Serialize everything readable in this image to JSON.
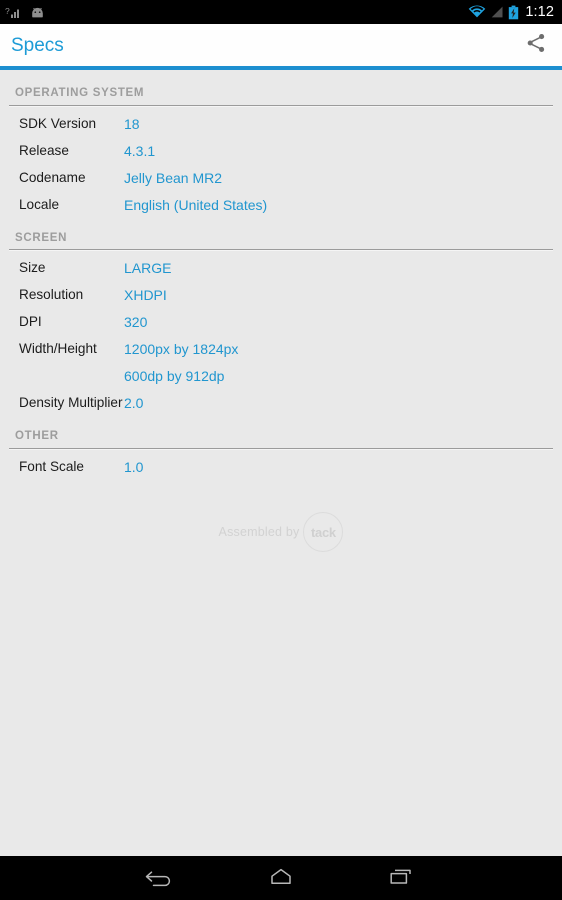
{
  "status_bar": {
    "left_icons": [
      "signal-unknown-icon",
      "android-head-icon"
    ],
    "wifi_icon": "wifi-icon",
    "signal_icon": "cell-signal-icon",
    "battery_icon": "battery-charging-icon",
    "clock": "1:12",
    "clock_color": "#ffffff",
    "background": "#000000"
  },
  "action_bar": {
    "title": "Specs",
    "title_color": "#1d9bd6",
    "share_icon": "share-icon",
    "underline_color": "#1d8fd0",
    "background": "#fefefe"
  },
  "theme": {
    "accent": "#2196cf",
    "page_background": "#e9e9e9",
    "label_color": "#1c1c1c",
    "section_header_color": "#9d9d9d"
  },
  "sections": [
    {
      "header": "OPERATING SYSTEM",
      "rows": [
        {
          "label": "SDK Version",
          "values": [
            "18"
          ]
        },
        {
          "label": "Release",
          "values": [
            "4.3.1"
          ]
        },
        {
          "label": "Codename",
          "values": [
            "Jelly Bean MR2"
          ]
        },
        {
          "label": "Locale",
          "values": [
            "English (United States)"
          ]
        }
      ]
    },
    {
      "header": "SCREEN",
      "rows": [
        {
          "label": "Size",
          "values": [
            "LARGE"
          ]
        },
        {
          "label": "Resolution",
          "values": [
            "XHDPI"
          ]
        },
        {
          "label": "DPI",
          "values": [
            "320"
          ]
        },
        {
          "label": "Width/Height",
          "values": [
            "1200px by 1824px",
            "600dp by 912dp"
          ]
        },
        {
          "label": "Density Multiplier",
          "values": [
            "2.0"
          ]
        }
      ]
    },
    {
      "header": "OTHER",
      "rows": [
        {
          "label": "Font Scale",
          "values": [
            "1.0"
          ]
        }
      ]
    }
  ],
  "watermark": {
    "text": "Assembled by",
    "logo_text": "tack",
    "color": "#d2d2d2"
  },
  "nav_bar": {
    "back_icon": "back-arrow-icon",
    "home_icon": "home-icon",
    "recents_icon": "recent-apps-icon",
    "background": "#000000"
  }
}
